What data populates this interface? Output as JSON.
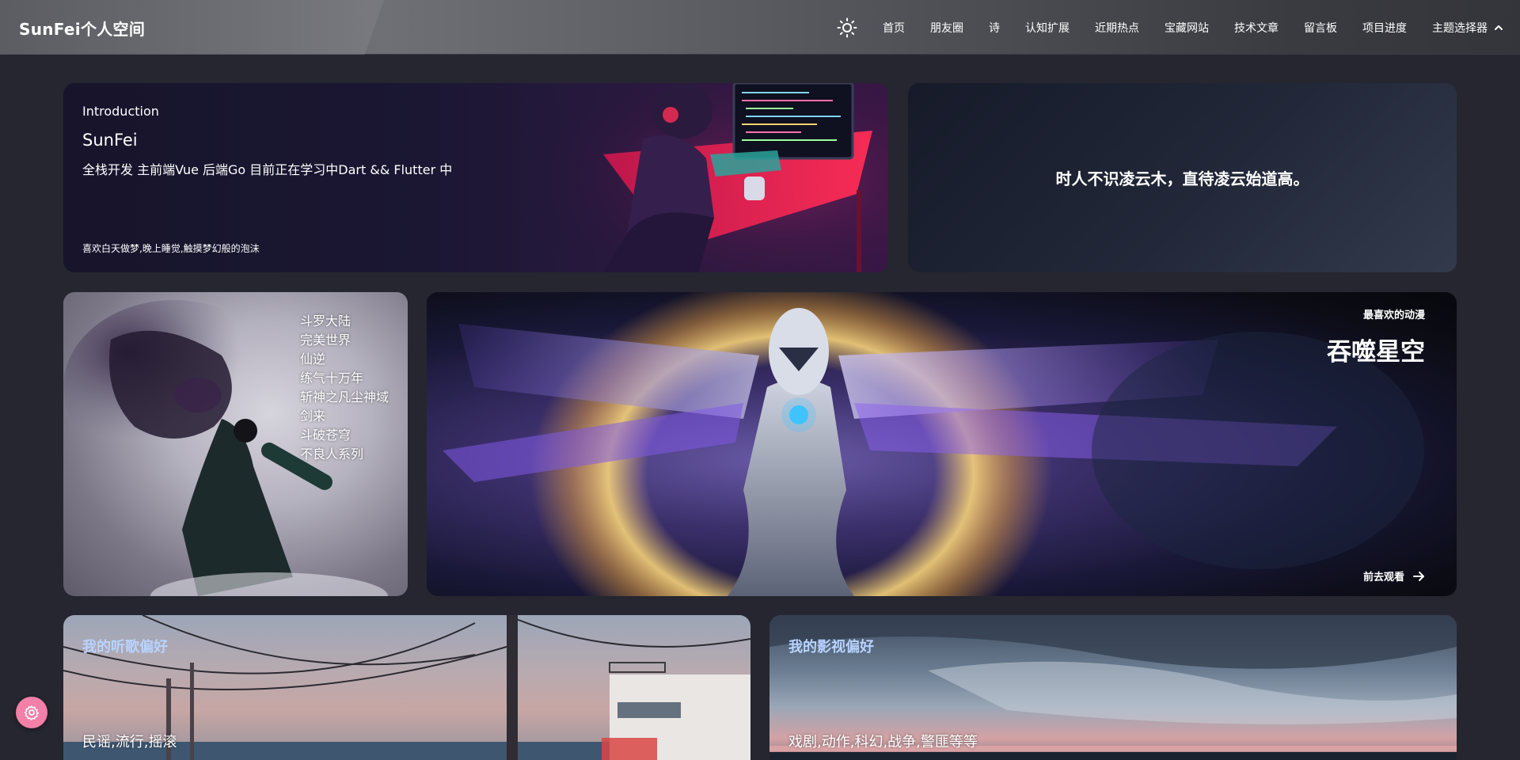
{
  "header": {
    "brand": "SunFei个人空间",
    "theme_icon": "sun-icon",
    "nav": [
      {
        "label": "首页"
      },
      {
        "label": "朋友圈"
      },
      {
        "label": "诗"
      },
      {
        "label": "认知扩展"
      },
      {
        "label": "近期热点"
      },
      {
        "label": "宝藏网站"
      },
      {
        "label": "技术文章"
      },
      {
        "label": "留言板"
      },
      {
        "label": "项目进度"
      },
      {
        "label": "主题选择器"
      }
    ]
  },
  "intro": {
    "label": "Introduction",
    "name": "SunFei",
    "description": "全栈开发 主前端Vue 后端Go 目前正在学习中Dart && Flutter 中",
    "hobby": "喜欢白天做梦,晚上睡觉,触摸梦幻般的泡沫"
  },
  "quote": {
    "text": "时人不识凌云木，直待凌云始道高。"
  },
  "novels": {
    "items": [
      "斗罗大陆",
      "完美世界",
      "仙逆",
      "练气十万年",
      "斩神之凡尘神域",
      "剑来",
      "斗破苍穹",
      "不良人系列"
    ]
  },
  "anime": {
    "eyebrow": "最喜欢的动漫",
    "title": "吞噬星空",
    "cta": "前去观看"
  },
  "music": {
    "title": "我的听歌偏好",
    "genres": "民谣,流行,摇滚"
  },
  "movie": {
    "title": "我的影视偏好",
    "genres": "戏剧,动作,科幻,战争,警匪等等"
  },
  "colors": {
    "background": "#25262f",
    "accent_pink": "#f47fa7",
    "pref_title": "#b8d3ff"
  },
  "fab_icon": "settings-gear-icon"
}
